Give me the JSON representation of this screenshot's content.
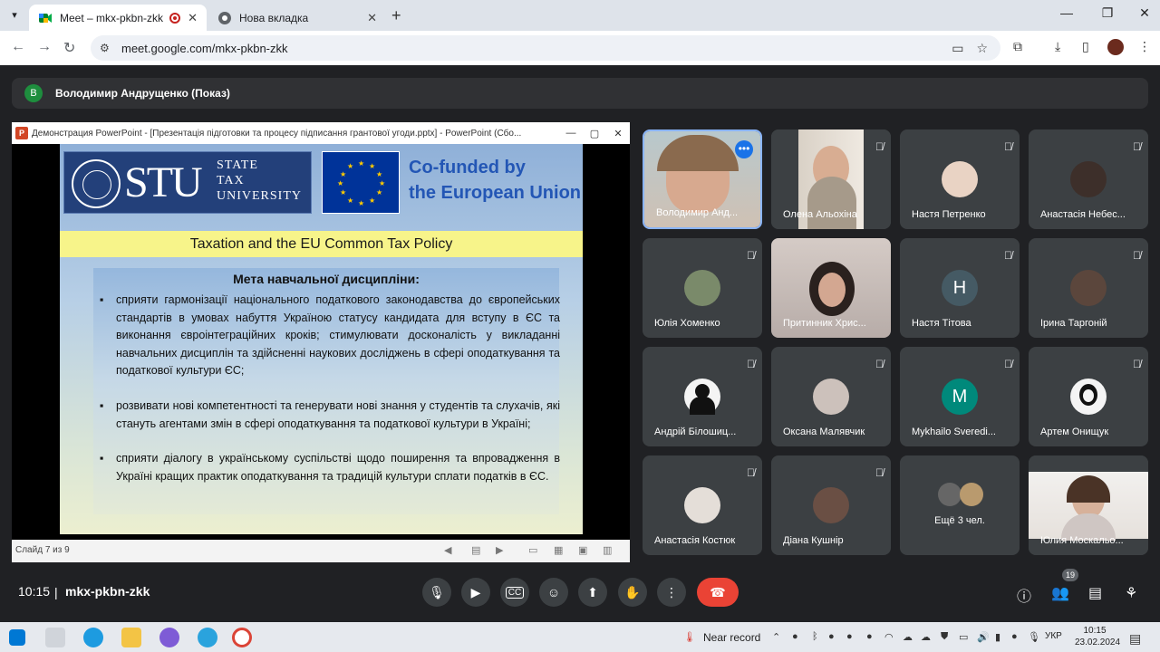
{
  "browser": {
    "tabs": [
      {
        "title": "Meet – mkx-pkbn-zkk",
        "active": true
      },
      {
        "title": "Нова вкладка",
        "active": false
      }
    ],
    "url": "meet.google.com/mkx-pkbn-zkk"
  },
  "presenter": {
    "initial": "В",
    "label": "Володимир Андрущенко (Показ)"
  },
  "powerpoint": {
    "window_title": "Демонстрация PowerPoint - [Презентація підготовки та процесу підписання грантової угоди.pptx] - PowerPoint (Сбо...",
    "status": "Слайд 7 из 9",
    "slide": {
      "logo_big": "STU",
      "logo_small_1": "STATE",
      "logo_small_2": "TAX",
      "logo_small_3": "UNIVERSITY",
      "cofunded_1": "Co-funded by",
      "cofunded_2": "the European Union",
      "band": "Taxation and the EU Common Tax Policy",
      "heading": "Мета навчальної дисципліни:",
      "bullets": [
        "сприяти гармонізації національного податкового законодавства до європейських стандартів в умовах набуття Україною статусу кандидата для вступу в ЄС та виконання євроінтеграційних кроків; стимулювати досконалість у викладанні навчальних дисциплін та здійсненні наукових досліджень в сфері оподаткування та податкової культури ЄС;",
        "розвивати нові компетентності та генерувати нові знання у студентів та слухачів, які стануть агентами змін в сфері оподаткування та податкової культури в Україні;",
        "сприяти діалогу в українському суспільстві щодо поширення та впровадження в Україні кращих практик оподаткування та традицій культури сплати податків в ЄС."
      ]
    }
  },
  "participants": [
    {
      "name": "Володимир Анд...",
      "kind": "video"
    },
    {
      "name": "Олена Альохіна",
      "kind": "video"
    },
    {
      "name": "Настя Петренко",
      "kind": "avatar"
    },
    {
      "name": "Анастасія Небес...",
      "kind": "avatar"
    },
    {
      "name": "Юлія Хоменко",
      "kind": "avatar"
    },
    {
      "name": "Притинник Хрис...",
      "kind": "video"
    },
    {
      "name": "Настя Тітова",
      "kind": "letter",
      "letter": "Н"
    },
    {
      "name": "Ірина Таргоній",
      "kind": "avatar"
    },
    {
      "name": "Андрій Білошиц...",
      "kind": "avatar"
    },
    {
      "name": "Оксана Малявчик",
      "kind": "avatar"
    },
    {
      "name": "Mykhailo Sveredi...",
      "kind": "letter",
      "letter": "M"
    },
    {
      "name": "Артем Онищук",
      "kind": "avatar"
    },
    {
      "name": "Анастасія Костюк",
      "kind": "avatar"
    },
    {
      "name": "Діана Кушнір",
      "kind": "avatar"
    },
    {
      "name": "Ещё 3 чел.",
      "kind": "more"
    },
    {
      "name": "Юлия Москальо...",
      "kind": "video"
    }
  ],
  "meet_bar": {
    "time": "10:15",
    "separator": "|",
    "code": "mkx-pkbn-zkk",
    "people_count": "19"
  },
  "taskbar": {
    "weather": "Near record",
    "lang": "УКР",
    "time": "10:15",
    "date": "23.02.2024"
  }
}
